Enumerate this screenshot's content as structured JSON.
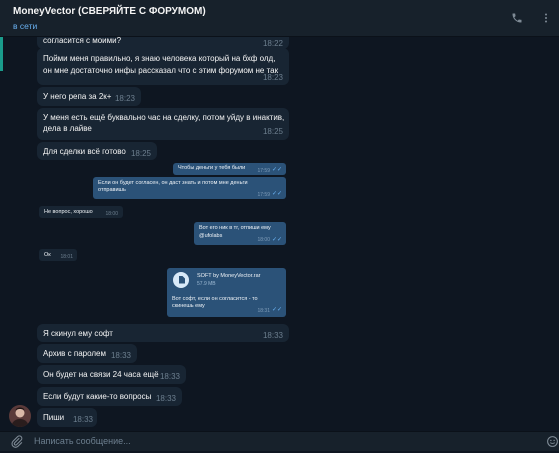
{
  "header": {
    "title": "MoneyVector (СВЕРЯЙТЕ С ФОРУМОМ)",
    "status": "в сети",
    "icons": [
      "phone-icon",
      "search-icon",
      "more-icon"
    ]
  },
  "messages": [
    {
      "text": "согласится с моими?",
      "time": "18:22"
    },
    {
      "text": "Пойми меня правильно, я знаю человека который на бхф олд,",
      "text2": "он мне достаточно инфы рассказал что с этим форумом не так",
      "time": "18:23"
    },
    {
      "text": "У него репа за 2к+",
      "time": "18:23"
    },
    {
      "text": "У меня есть ещё буквально час на сделку, потом уйду в инактив,",
      "text2": "дела в лайве",
      "time": "18:25"
    },
    {
      "text": "Для сделки всё готово",
      "time": "18:25"
    },
    {
      "text": "Я скинул ему софт",
      "time": "18:33"
    },
    {
      "text": "Архив с паролем",
      "time": "18:33"
    },
    {
      "text": "Он будет на связи 24 часа ещё",
      "time": "18:33"
    },
    {
      "text": "Если будут какие-то вопросы",
      "time": "18:33"
    },
    {
      "text": "Пиши",
      "time": "18:33"
    }
  ],
  "screenshot": {
    "messages": [
      {
        "side": "out",
        "text": "Чтобы деньги у тебя были",
        "time": "17:59"
      },
      {
        "side": "out",
        "text": "Если он будет согласен, он даст знать и потом мне деньги",
        "text2": "отправишь",
        "time": "17:59"
      },
      {
        "side": "in",
        "text": "Не вопрос, хорошо",
        "time": "18:00"
      },
      {
        "side": "out",
        "text": "Вот его ник в тг, отпиши ему",
        "text2": "@ufolabs",
        "time": "18:00"
      },
      {
        "side": "in",
        "text": "Ок",
        "time": "18:01"
      }
    ],
    "file": {
      "name": "SOFT by MoneyVector.rar",
      "size": "57.9 MB",
      "caption": "Вот софт, если он согласится - то",
      "caption2": "скинешь ему",
      "time": "18:31"
    }
  },
  "composer": {
    "placeholder": "Написать сообщение..."
  },
  "colors": {
    "background": "#0e1621",
    "header": "#17212b",
    "incoming_bubble": "#182533",
    "outgoing_bubble": "#2b5278",
    "accent": "#6ab2f2"
  }
}
